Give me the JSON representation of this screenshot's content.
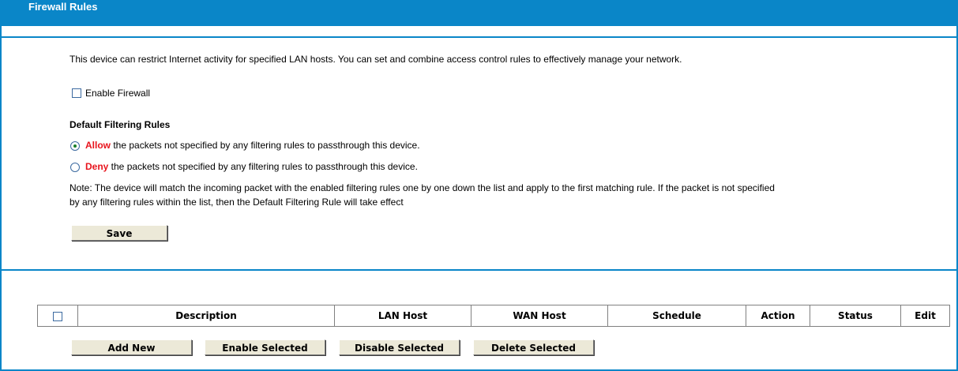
{
  "header": {
    "title": "Firewall Rules"
  },
  "intro": "This device can restrict Internet activity for specified LAN hosts. You can set and combine access control rules to effectively manage your network.",
  "enable_firewall": {
    "label": "Enable Firewall",
    "checked": false
  },
  "default_rules": {
    "heading": "Default Filtering Rules",
    "allow": {
      "keyword": "Allow",
      "text": " the packets not specified by any filtering rules to passthrough this device.",
      "selected": true
    },
    "deny": {
      "keyword": "Deny",
      "text": " the packets not specified by any filtering rules to passthrough this device.",
      "selected": false
    },
    "note_line1": "Note: The device will match the incoming packet with the enabled filtering rules one by one down the list and apply to the first matching rule. If the packet is not specified",
    "note_line2": "by any filtering rules within the list, then the Default Filtering Rule will take effect"
  },
  "save_label": "Save",
  "table": {
    "columns": [
      "Description",
      "LAN Host",
      "WAN Host",
      "Schedule",
      "Action",
      "Status",
      "Edit"
    ]
  },
  "actions": {
    "add_new": "Add New",
    "enable_selected": "Enable Selected",
    "disable_selected": "Disable Selected",
    "delete_selected": "Delete Selected"
  },
  "colors": {
    "accent": "#0a86c8",
    "highlight": "#e8141d"
  }
}
